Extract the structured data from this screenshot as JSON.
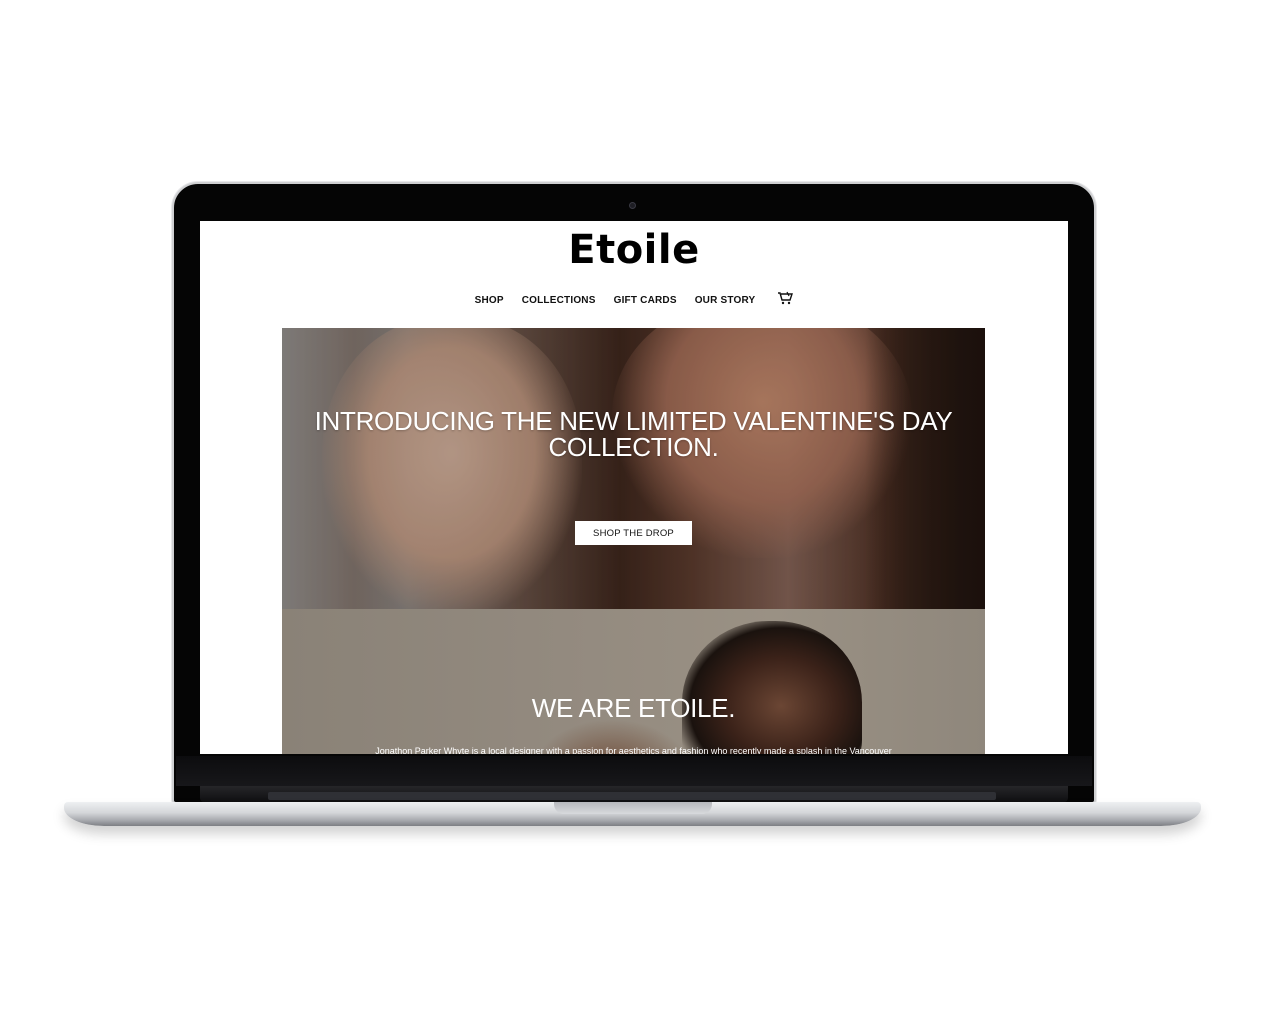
{
  "site": {
    "logo": "Etoile"
  },
  "nav": {
    "items": [
      {
        "label": "SHOP"
      },
      {
        "label": "COLLECTIONS"
      },
      {
        "label": "GIFT CARDS"
      },
      {
        "label": "OUR STORY"
      }
    ],
    "cart_icon": "cart-icon"
  },
  "hero": {
    "title_line1": "INTRODUCING THE NEW LIMITED VALENTINE'S DAY",
    "title_line2": "COLLECTION.",
    "button_label": "SHOP THE DROP"
  },
  "about": {
    "title": "WE ARE ETOILE.",
    "text": "Jonathon Parker Whyte is a local designer with a passion for aesthetics and fashion who recently made a splash in the Vancouver"
  },
  "colors": {
    "laptop_bezel": "#050505",
    "laptop_base": "#d4d6d9",
    "hero_text": "#ffffff",
    "button_bg": "#ffffff"
  }
}
